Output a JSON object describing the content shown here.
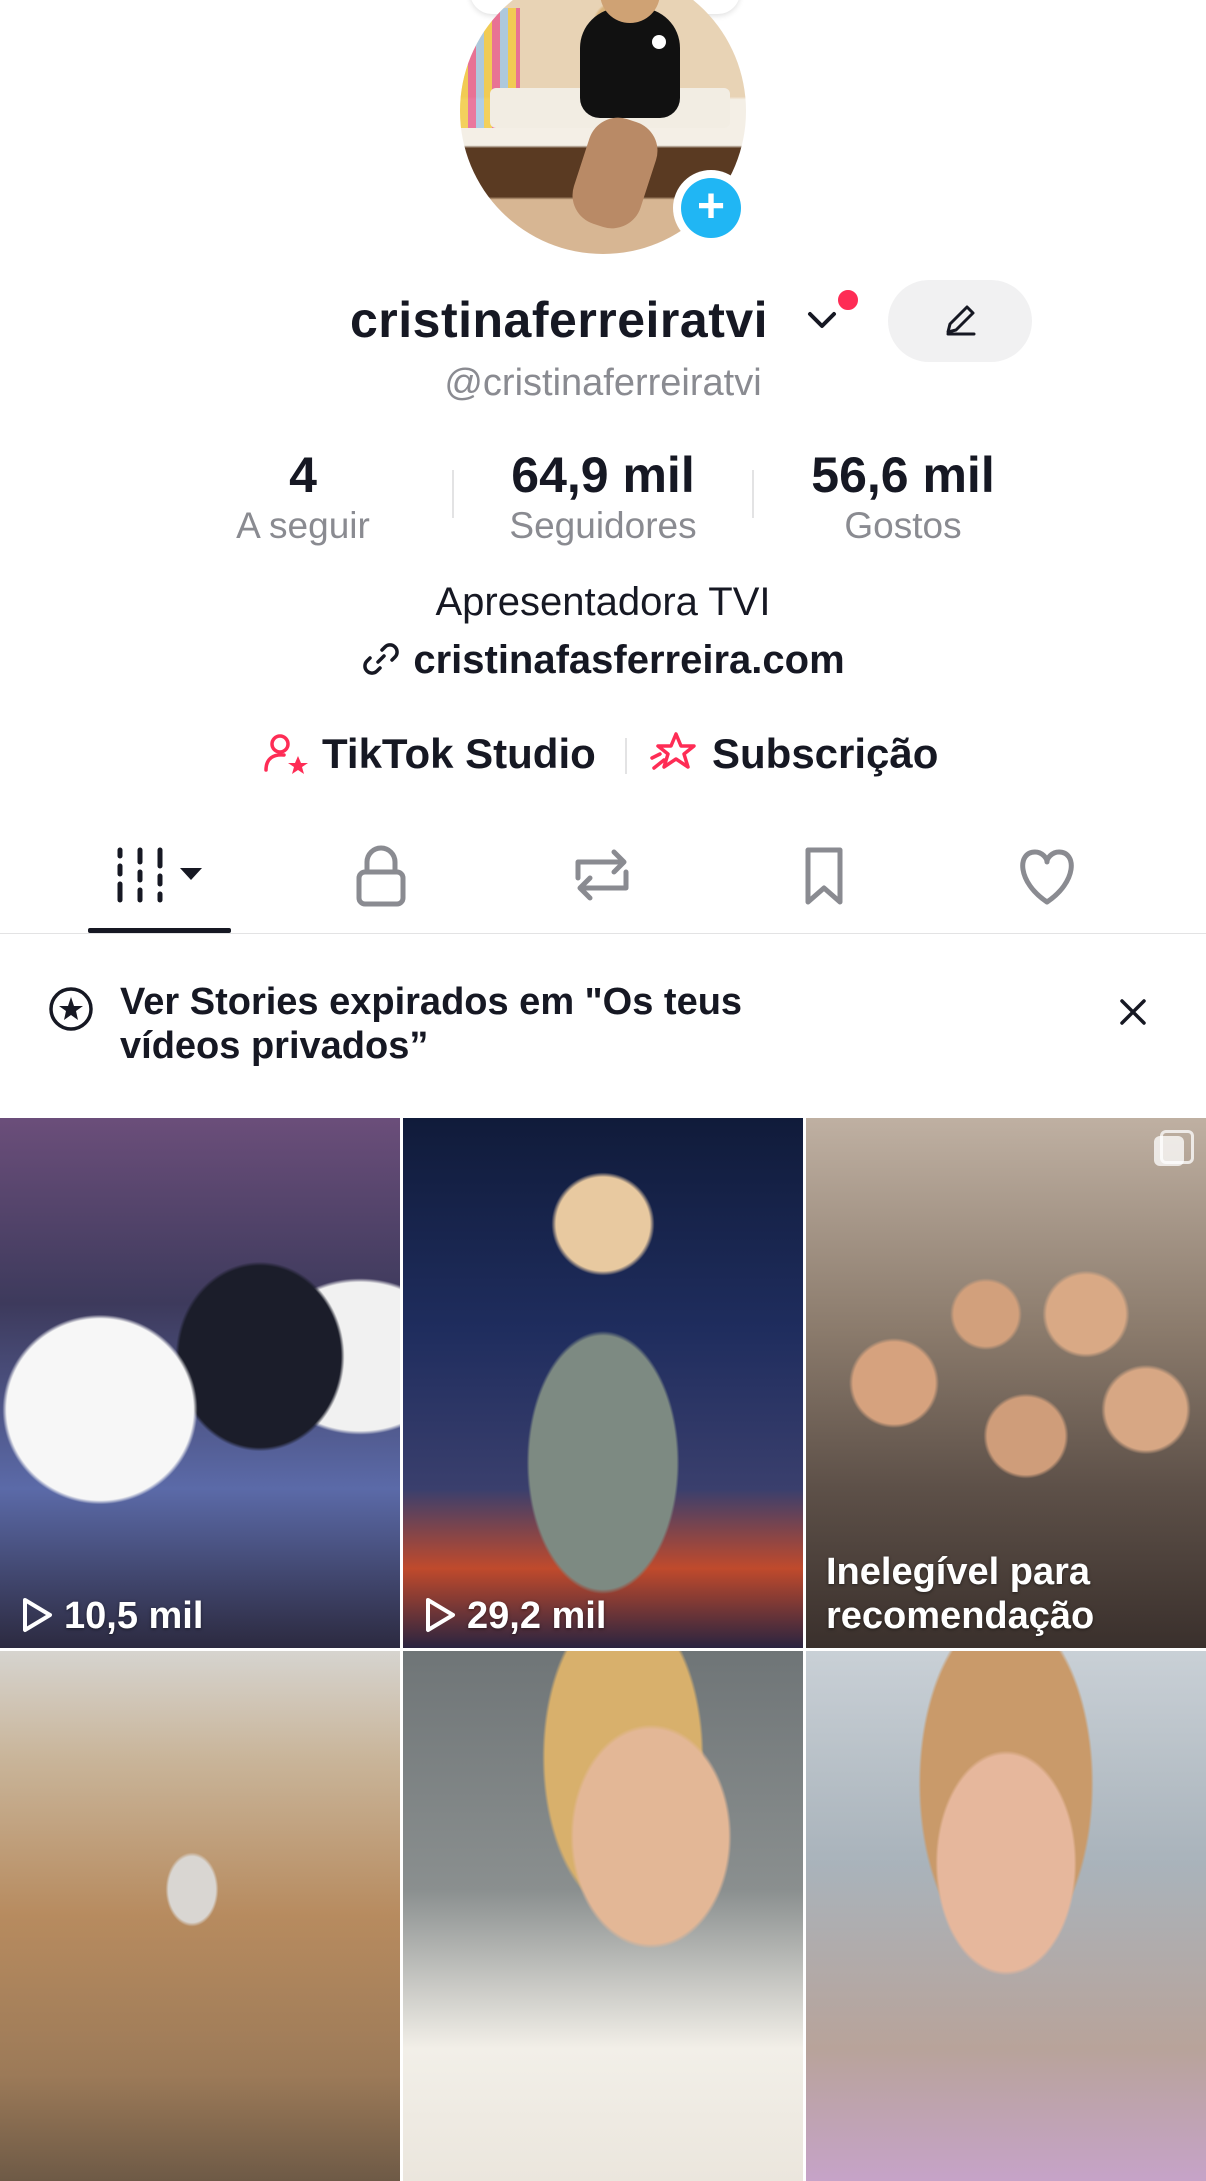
{
  "profile": {
    "username": "cristinaferreiratvi",
    "handle": "@cristinaferreiratvi",
    "bio": "Apresentadora TVI",
    "website": "cristinafasferreira.com"
  },
  "stats": [
    {
      "value": "4",
      "label": "A seguir"
    },
    {
      "value": "64,9 mil",
      "label": "Seguidores"
    },
    {
      "value": "56,6 mil",
      "label": "Gostos"
    }
  ],
  "tools": {
    "studio_label": "TikTok Studio",
    "subscription_label": "Subscrição"
  },
  "tabs": [
    {
      "name": "videos-tab",
      "icon": "grid-filter-icon",
      "active": true
    },
    {
      "name": "private-tab",
      "icon": "lock-icon",
      "active": false
    },
    {
      "name": "reposts-tab",
      "icon": "repost-icon",
      "active": false
    },
    {
      "name": "saved-tab",
      "icon": "bookmark-icon",
      "active": false
    },
    {
      "name": "liked-tab",
      "icon": "heart-icon",
      "active": false
    }
  ],
  "banner": {
    "text": "Ver Stories expirados em \"Os teus vídeos privados”"
  },
  "videos": [
    {
      "views": "10,5 mil"
    },
    {
      "views": "29,2 mil"
    },
    {
      "status": "Inelegível para recomendação"
    },
    {
      "views": ""
    },
    {
      "views": ""
    },
    {
      "views": ""
    }
  ],
  "colors": {
    "accent_red": "#fe2c55",
    "add_blue": "#20b6f4",
    "secondary_text": "#8a8b91"
  }
}
